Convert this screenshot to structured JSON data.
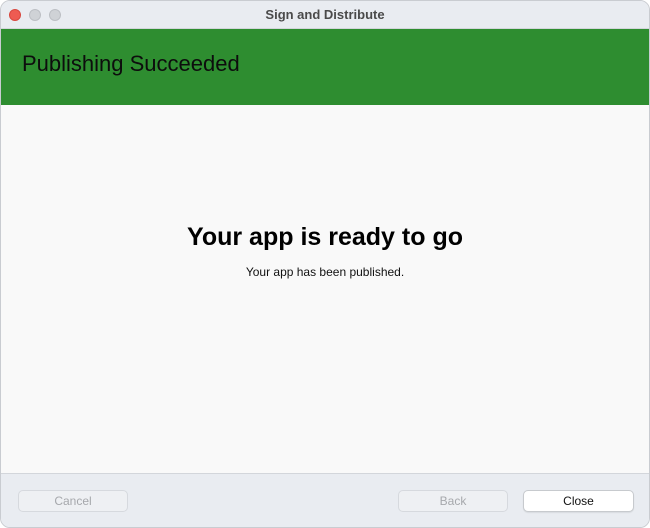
{
  "window": {
    "title": "Sign and Distribute"
  },
  "banner": {
    "title": "Publishing Succeeded",
    "color": "#2e8d30"
  },
  "main": {
    "headline": "Your app is ready to go",
    "subtext": "Your app has been published."
  },
  "footer": {
    "cancel_label": "Cancel",
    "back_label": "Back",
    "close_label": "Close"
  }
}
